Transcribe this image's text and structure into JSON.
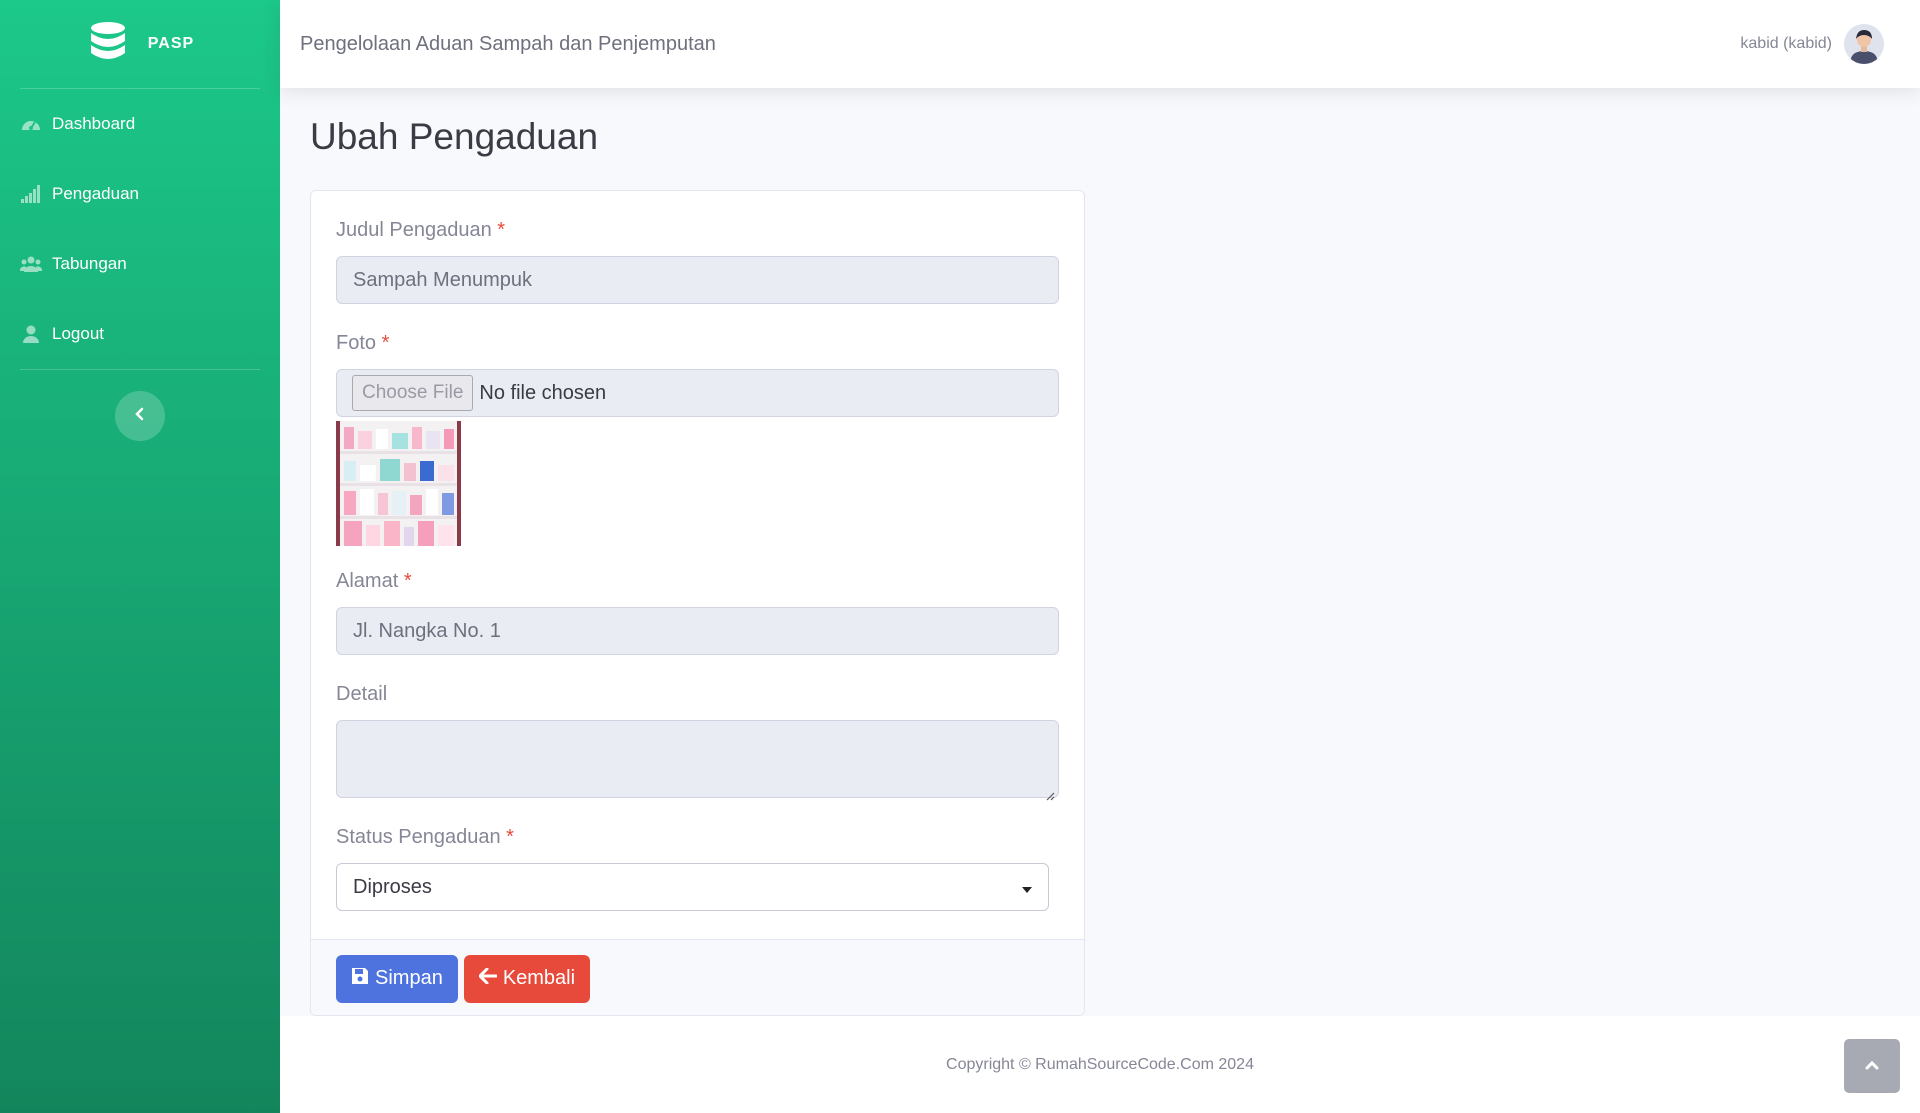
{
  "brand": {
    "name": "PASP",
    "logo_icon": "database-icon"
  },
  "sidebar": {
    "items": [
      {
        "label": "Dashboard",
        "icon": "tachometer-icon"
      },
      {
        "label": "Pengaduan",
        "icon": "signal-icon"
      },
      {
        "label": "Tabungan",
        "icon": "users-icon"
      },
      {
        "label": "Logout",
        "icon": "user-icon"
      }
    ],
    "toggle_icon": "chevron-left-icon"
  },
  "topbar": {
    "title": "Pengelolaan Aduan Sampah dan Penjemputan",
    "user_name": "kabid (kabid)"
  },
  "page": {
    "title": "Ubah Pengaduan"
  },
  "form": {
    "required_mark": "*",
    "judul": {
      "label": "Judul Pengaduan",
      "value": "Sampah Menumpuk"
    },
    "foto": {
      "label": "Foto",
      "button": "Choose File",
      "status": "No file chosen"
    },
    "alamat": {
      "label": "Alamat",
      "value": "Jl. Nangka No. 1"
    },
    "detail": {
      "label": "Detail",
      "value": ""
    },
    "status": {
      "label": "Status Pengaduan",
      "selected": "Diproses"
    }
  },
  "actions": {
    "save": "Simpan",
    "back": "Kembali"
  },
  "footer": {
    "copyright": "Copyright © RumahSourceCode.Com 2024"
  },
  "colors": {
    "sidebar_top": "#1cc88a",
    "sidebar_bottom": "#13855c",
    "primary": "#4e73df",
    "danger": "#e74a3b"
  }
}
